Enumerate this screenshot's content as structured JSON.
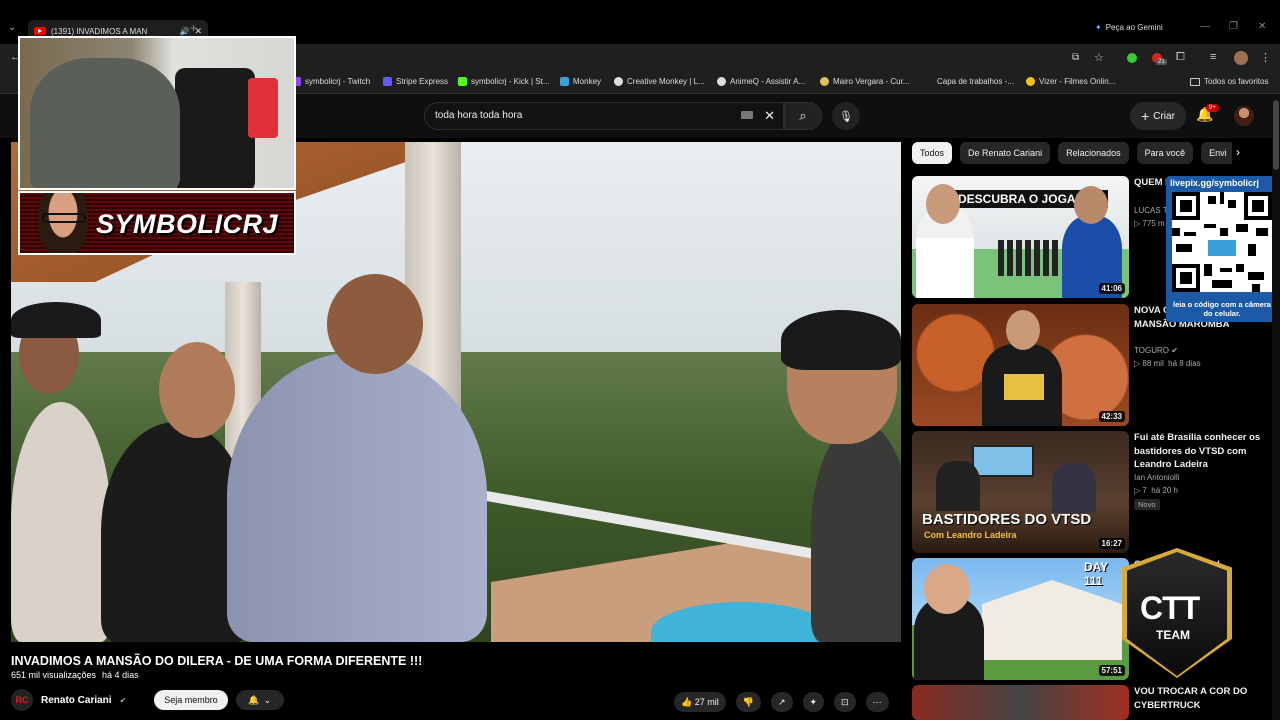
{
  "browser": {
    "tab_title": "(1391) INVADIMOS A MAN",
    "gemini_label": "Peça ao Gemini",
    "extension_badge": "21",
    "bookmarks": [
      {
        "label": "symbolicrj - Twitch",
        "color": "#9146ff"
      },
      {
        "label": "Stripe Express",
        "color": "#635bff"
      },
      {
        "label": "symbolicrj - Kick | St...",
        "color": "#53fc18"
      },
      {
        "label": "Monkey",
        "color": "#3ba0d8"
      },
      {
        "label": "Creative Monkey | L...",
        "color": "#dddddd"
      },
      {
        "label": "AnimeQ - Assistir A...",
        "color": "#dddddd"
      },
      {
        "label": "Mairo Vergara - Cur...",
        "color": "#e0c060"
      },
      {
        "label": "Capa de trabalhos -...",
        "color": "#1f1f1f"
      },
      {
        "label": "Vizer - Filmes Onlin...",
        "color": "#f0c020"
      }
    ],
    "all_bookmarks": "Todos os favoritos"
  },
  "youtube": {
    "search_value": "toda hora toda hora",
    "create_label": "Criar",
    "notif_count": "9+"
  },
  "overlay": {
    "streamer_name": "SYMBOLICRJ",
    "qr_url": "livepix.gg/symbolicrj",
    "qr_caption": "leia o código com a câmera do celular.",
    "badge_line1": "CTT",
    "badge_line2": "TEAM"
  },
  "video": {
    "title": "INVADIMOS A MANSÃO DO DILERA - DE UMA FORMA DIFERENTE !!!",
    "views": "651 mil visualizações",
    "age": "há 4 dias",
    "channel": "Renato Cariani",
    "channel_logo": "RC",
    "join_label": "Seja membro",
    "likes": "27 mil"
  },
  "chips": [
    "Todos",
    "De Renato Cariani",
    "Relacionados",
    "Para você",
    "Envi"
  ],
  "recommendations": [
    {
      "title": "QUEM É PROFIS",
      "channel": "LUCAS T",
      "views": "775 m",
      "duration": "41:06",
      "thumb_text": "DESCUBRA O JOGADOR"
    },
    {
      "title": "NOVA C DE OVO DA MANSÃO MAROMBA",
      "channel": "TOGURO",
      "views": "88 mil",
      "age": "há 8 dias",
      "duration": "42:33"
    },
    {
      "title": "Fui até Brasília conhecer os bastidores do VTSD com Leandro Ladeira",
      "channel": "Ian Antoniolli",
      "views": "7",
      "age": "há 20 h",
      "badge": "Novo",
      "duration": "16:27",
      "thumb_text": "BASTIDORES DO VTSD",
      "thumb_sub": "Com Leandro Ladeira"
    },
    {
      "title": "Que Mansão Por a!",
      "channel": "",
      "views": "",
      "duration": "57:51",
      "thumb_text": "DAY 111"
    },
    {
      "title": "VOU TROCAR A COR DO CYBERTRUCK",
      "channel": "",
      "views": "",
      "duration": ""
    }
  ]
}
